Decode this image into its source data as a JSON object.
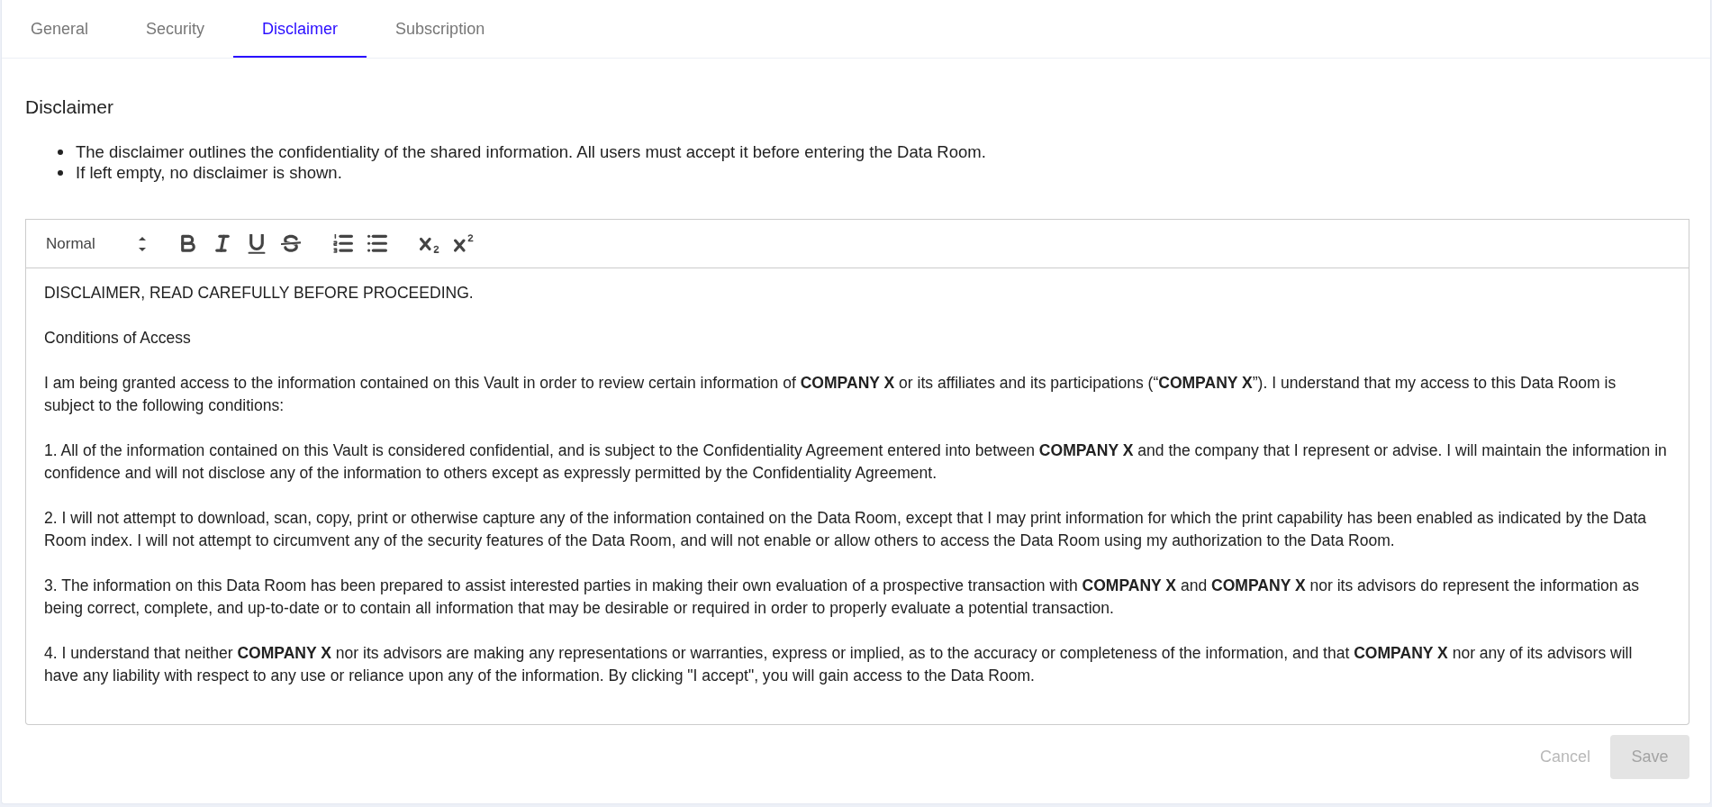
{
  "tabs": [
    {
      "label": "General",
      "selected": false
    },
    {
      "label": "Security",
      "selected": false
    },
    {
      "label": "Disclaimer",
      "selected": true
    },
    {
      "label": "Subscription",
      "selected": false
    }
  ],
  "section": {
    "title": "Disclaimer",
    "notes": [
      "The disclaimer outlines the confidentiality of the shared information. All users must accept it before entering the Data Room.",
      "If left empty, no disclaimer is shown."
    ]
  },
  "editor": {
    "format": "Normal",
    "paragraphs": [
      "DISCLAIMER, READ CAREFULLY BEFORE PROCEEDING.",
      "Conditions of Access",
      "I am being granted access to the information contained on this Vault in order to review certain information of **COMPANY X** or its affiliates and its participations (“**COMPANY X**”). I understand that my access to this Data Room is subject to the following conditions:",
      "1. All of the information contained on this Vault is considered confidential, and is subject to the Confidentiality Agreement entered into between **COMPANY X** and the company that I represent or advise. I will maintain the information in confidence and will not disclose any of the information to others except as expressly permitted by the Confidentiality Agreement.",
      "2. I will not attempt to download, scan, copy, print or otherwise capture any of the information contained on the Data Room, except that I may print information for which the print capability has been enabled as indicated by the Data Room index. I will not attempt to circumvent any of the security features of the Data Room, and will not enable or allow others to access the Data Room using my authorization to the Data Room.",
      "3. The information on this Data Room has been prepared to assist interested parties in making their own evaluation of a prospective transaction with **COMPANY X** and **COMPANY X** nor its advisors do represent the information as being correct, complete, and up-to-date or to contain all information that may be desirable or required in order to properly evaluate a potential transaction.",
      "4. I understand that neither **COMPANY X** nor its advisors are making any representations or warranties, express or implied, as to the accuracy or completeness of the information, and that **COMPANY X** nor any of its advisors will have any liability with respect to any use or reliance upon any of the information. By clicking \"I accept\", you will gain access to the Data Room."
    ]
  },
  "actions": [
    {
      "label": "Cancel",
      "kind": "text",
      "disabled": true
    },
    {
      "label": "Save",
      "kind": "filled",
      "disabled": true
    }
  ]
}
